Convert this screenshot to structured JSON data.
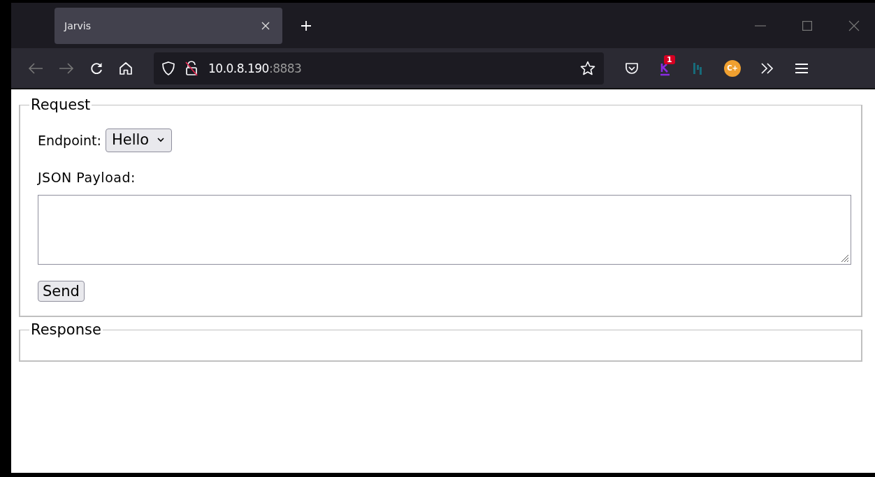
{
  "browser": {
    "tabs": [
      {
        "title": "Jarvis",
        "selected": true
      }
    ],
    "address": {
      "host": "10.0.8.190",
      "port": ":8883"
    },
    "extensions": [
      {
        "kind": "k-logo",
        "badge": "1"
      },
      {
        "kind": "bars"
      },
      {
        "kind": "circle",
        "label": "C+"
      }
    ]
  },
  "request": {
    "legend": "Request",
    "endpoint_label": "Endpoint:",
    "endpoint_value": "Hello",
    "payload_label": "JSON Payload:",
    "send_label": "Send"
  },
  "response": {
    "legend": "Response"
  }
}
